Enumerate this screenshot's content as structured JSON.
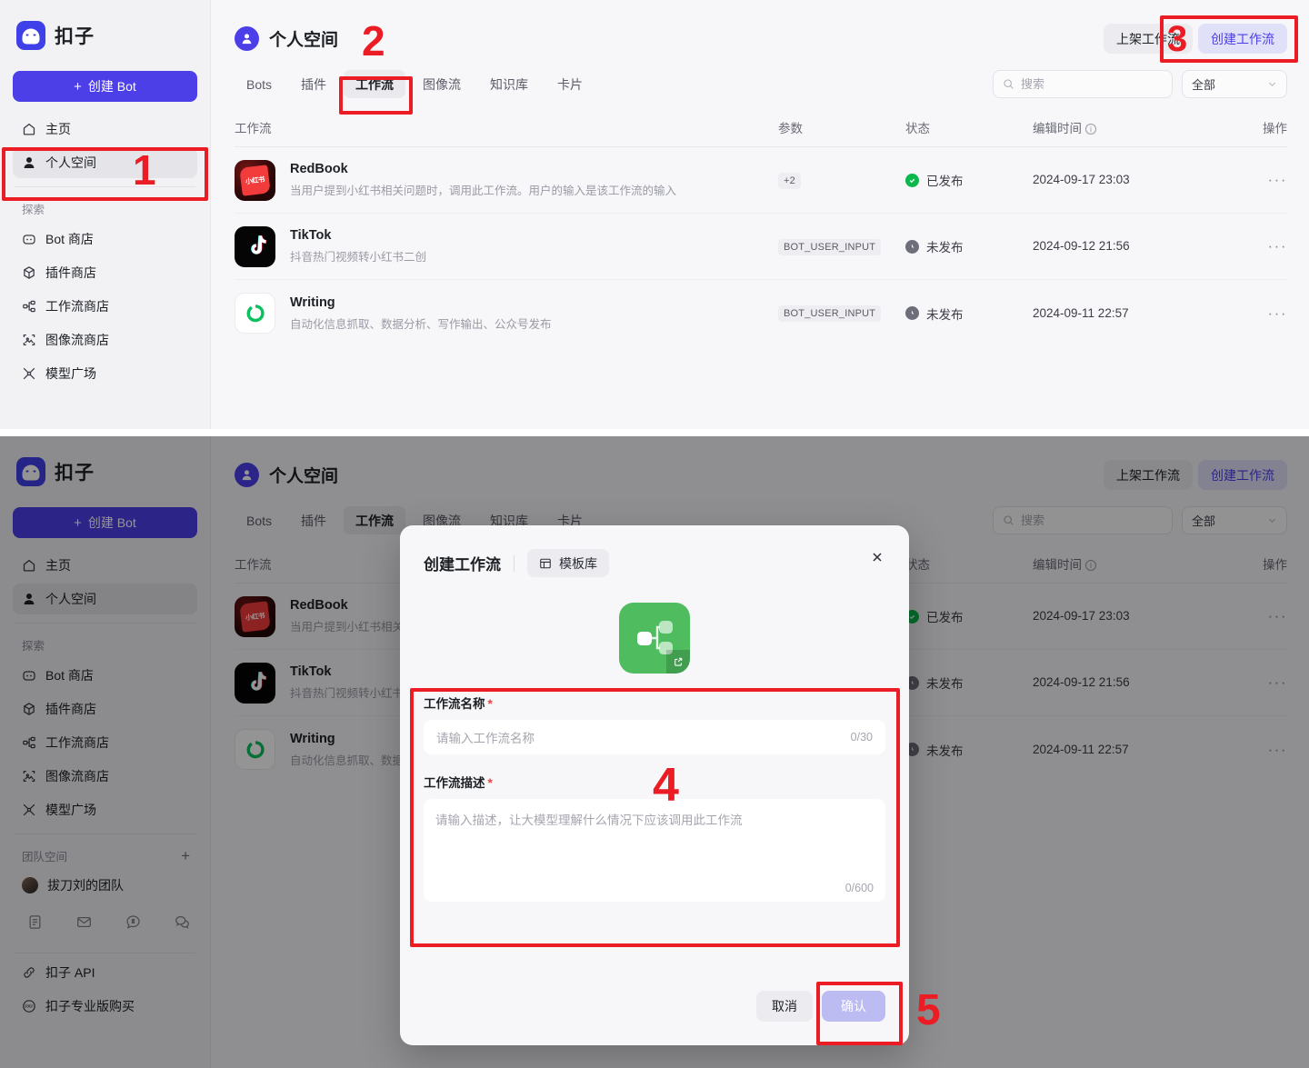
{
  "brand": {
    "name": "扣子"
  },
  "sidebar": {
    "create_bot": "创建 Bot",
    "nav": [
      {
        "label": "主页",
        "icon": "home-icon"
      },
      {
        "label": "个人空间",
        "icon": "user-icon"
      }
    ],
    "explore_label": "探索",
    "explore": [
      {
        "label": "Bot 商店",
        "icon": "bot-store-icon"
      },
      {
        "label": "插件商店",
        "icon": "plugin-store-icon"
      },
      {
        "label": "工作流商店",
        "icon": "workflow-store-icon"
      },
      {
        "label": "图像流商店",
        "icon": "imageflow-store-icon"
      },
      {
        "label": "模型广场",
        "icon": "model-plaza-icon"
      }
    ],
    "team_label": "团队空间",
    "team_items": [
      {
        "label": "拔刀刘的团队"
      }
    ],
    "social_icons": [
      "docs-icon",
      "mail-icon",
      "feedback-icon",
      "wechat-icon"
    ],
    "bottom_links": [
      {
        "label": "扣子 API",
        "icon": "api-icon"
      },
      {
        "label": "扣子专业版购买",
        "icon": "pay-icon"
      }
    ]
  },
  "header": {
    "title": "个人空间",
    "publish_button": "上架工作流",
    "create_button": "创建工作流"
  },
  "tabs": [
    {
      "label": "Bots",
      "active": false
    },
    {
      "label": "插件",
      "active": false
    },
    {
      "label": "工作流",
      "active": true
    },
    {
      "label": "图像流",
      "active": false
    },
    {
      "label": "知识库",
      "active": false
    },
    {
      "label": "卡片",
      "active": false
    }
  ],
  "search": {
    "placeholder": "搜索",
    "value": ""
  },
  "filter": {
    "selected": "全部"
  },
  "table": {
    "columns": {
      "name": "工作流",
      "param": "参数",
      "status": "状态",
      "time": "编辑时间",
      "ops": "操作"
    },
    "rows": [
      {
        "icon": "redbook-icon",
        "icon_text": "小红书",
        "name": "RedBook",
        "desc": "当用户提到小红书相关问题时，调用此工作流。用户的输入是该工作流的输入",
        "param": "+2",
        "status": "已发布",
        "status_type": "published",
        "time": "2024-09-17 23:03",
        "ops": "···"
      },
      {
        "icon": "tiktok-icon",
        "icon_text": "",
        "name": "TikTok",
        "desc": "抖音热门视频转小红书二创",
        "param": "BOT_USER_INPUT",
        "status": "未发布",
        "status_type": "unpublished",
        "time": "2024-09-12 21:56",
        "ops": "···"
      },
      {
        "icon": "writing-icon",
        "icon_text": "",
        "name": "Writing",
        "desc": "自动化信息抓取、数据分析、写作输出、公众号发布",
        "param": "BOT_USER_INPUT",
        "status": "未发布",
        "status_type": "unpublished",
        "time": "2024-09-11 22:57",
        "ops": "···"
      }
    ]
  },
  "modal": {
    "title": "创建工作流",
    "template_button": "模板库",
    "name_label": "工作流名称",
    "name_placeholder": "请输入工作流名称",
    "name_counter": "0/30",
    "desc_label": "工作流描述",
    "desc_placeholder": "请输入描述，让大模型理解什么情况下应该调用此工作流",
    "desc_counter": "0/600",
    "cancel": "取消",
    "confirm": "确认"
  },
  "annotations": {
    "color": "#ec1c24",
    "numbers": [
      "1",
      "2",
      "3",
      "4",
      "5"
    ]
  }
}
